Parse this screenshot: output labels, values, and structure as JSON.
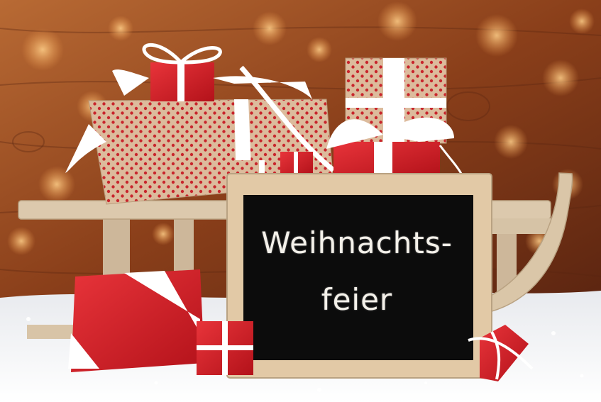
{
  "chalkboard": {
    "line_1": "Weihnachts-",
    "line_2": "feier"
  },
  "colors": {
    "wood_background": "#8a3f1a",
    "bokeh": "#f4b060",
    "snow": "#f7f7f9",
    "gift_red": "#d21f26",
    "kraft_paper": "#d9b99a",
    "polka_dot": "#c8252c",
    "ribbon": "#ffffff",
    "chalkboard": "#0c0c0c",
    "frame_wood": "#e2c9a6",
    "sled_wood": "#dcc9ad"
  }
}
